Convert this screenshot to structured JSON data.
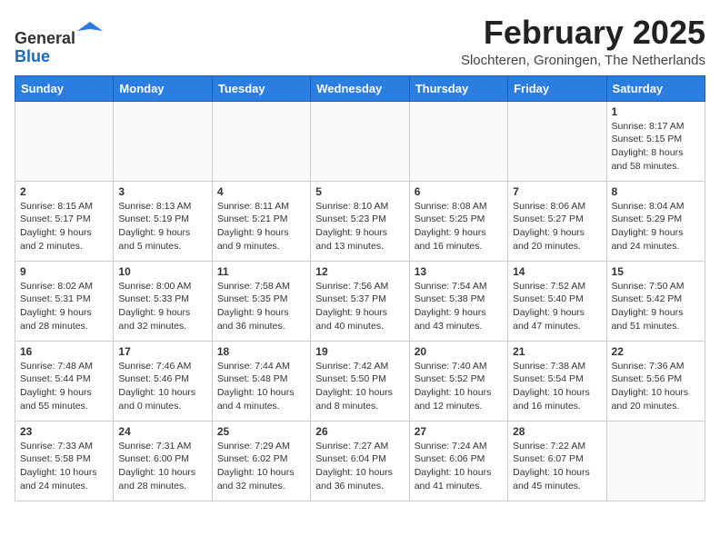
{
  "header": {
    "logo_line1": "General",
    "logo_line2": "Blue",
    "month_year": "February 2025",
    "location": "Slochteren, Groningen, The Netherlands"
  },
  "weekdays": [
    "Sunday",
    "Monday",
    "Tuesday",
    "Wednesday",
    "Thursday",
    "Friday",
    "Saturday"
  ],
  "weeks": [
    [
      {
        "day": "",
        "info": ""
      },
      {
        "day": "",
        "info": ""
      },
      {
        "day": "",
        "info": ""
      },
      {
        "day": "",
        "info": ""
      },
      {
        "day": "",
        "info": ""
      },
      {
        "day": "",
        "info": ""
      },
      {
        "day": "1",
        "info": "Sunrise: 8:17 AM\nSunset: 5:15 PM\nDaylight: 8 hours and 58 minutes."
      }
    ],
    [
      {
        "day": "2",
        "info": "Sunrise: 8:15 AM\nSunset: 5:17 PM\nDaylight: 9 hours and 2 minutes."
      },
      {
        "day": "3",
        "info": "Sunrise: 8:13 AM\nSunset: 5:19 PM\nDaylight: 9 hours and 5 minutes."
      },
      {
        "day": "4",
        "info": "Sunrise: 8:11 AM\nSunset: 5:21 PM\nDaylight: 9 hours and 9 minutes."
      },
      {
        "day": "5",
        "info": "Sunrise: 8:10 AM\nSunset: 5:23 PM\nDaylight: 9 hours and 13 minutes."
      },
      {
        "day": "6",
        "info": "Sunrise: 8:08 AM\nSunset: 5:25 PM\nDaylight: 9 hours and 16 minutes."
      },
      {
        "day": "7",
        "info": "Sunrise: 8:06 AM\nSunset: 5:27 PM\nDaylight: 9 hours and 20 minutes."
      },
      {
        "day": "8",
        "info": "Sunrise: 8:04 AM\nSunset: 5:29 PM\nDaylight: 9 hours and 24 minutes."
      }
    ],
    [
      {
        "day": "9",
        "info": "Sunrise: 8:02 AM\nSunset: 5:31 PM\nDaylight: 9 hours and 28 minutes."
      },
      {
        "day": "10",
        "info": "Sunrise: 8:00 AM\nSunset: 5:33 PM\nDaylight: 9 hours and 32 minutes."
      },
      {
        "day": "11",
        "info": "Sunrise: 7:58 AM\nSunset: 5:35 PM\nDaylight: 9 hours and 36 minutes."
      },
      {
        "day": "12",
        "info": "Sunrise: 7:56 AM\nSunset: 5:37 PM\nDaylight: 9 hours and 40 minutes."
      },
      {
        "day": "13",
        "info": "Sunrise: 7:54 AM\nSunset: 5:38 PM\nDaylight: 9 hours and 43 minutes."
      },
      {
        "day": "14",
        "info": "Sunrise: 7:52 AM\nSunset: 5:40 PM\nDaylight: 9 hours and 47 minutes."
      },
      {
        "day": "15",
        "info": "Sunrise: 7:50 AM\nSunset: 5:42 PM\nDaylight: 9 hours and 51 minutes."
      }
    ],
    [
      {
        "day": "16",
        "info": "Sunrise: 7:48 AM\nSunset: 5:44 PM\nDaylight: 9 hours and 55 minutes."
      },
      {
        "day": "17",
        "info": "Sunrise: 7:46 AM\nSunset: 5:46 PM\nDaylight: 10 hours and 0 minutes."
      },
      {
        "day": "18",
        "info": "Sunrise: 7:44 AM\nSunset: 5:48 PM\nDaylight: 10 hours and 4 minutes."
      },
      {
        "day": "19",
        "info": "Sunrise: 7:42 AM\nSunset: 5:50 PM\nDaylight: 10 hours and 8 minutes."
      },
      {
        "day": "20",
        "info": "Sunrise: 7:40 AM\nSunset: 5:52 PM\nDaylight: 10 hours and 12 minutes."
      },
      {
        "day": "21",
        "info": "Sunrise: 7:38 AM\nSunset: 5:54 PM\nDaylight: 10 hours and 16 minutes."
      },
      {
        "day": "22",
        "info": "Sunrise: 7:36 AM\nSunset: 5:56 PM\nDaylight: 10 hours and 20 minutes."
      }
    ],
    [
      {
        "day": "23",
        "info": "Sunrise: 7:33 AM\nSunset: 5:58 PM\nDaylight: 10 hours and 24 minutes."
      },
      {
        "day": "24",
        "info": "Sunrise: 7:31 AM\nSunset: 6:00 PM\nDaylight: 10 hours and 28 minutes."
      },
      {
        "day": "25",
        "info": "Sunrise: 7:29 AM\nSunset: 6:02 PM\nDaylight: 10 hours and 32 minutes."
      },
      {
        "day": "26",
        "info": "Sunrise: 7:27 AM\nSunset: 6:04 PM\nDaylight: 10 hours and 36 minutes."
      },
      {
        "day": "27",
        "info": "Sunrise: 7:24 AM\nSunset: 6:06 PM\nDaylight: 10 hours and 41 minutes."
      },
      {
        "day": "28",
        "info": "Sunrise: 7:22 AM\nSunset: 6:07 PM\nDaylight: 10 hours and 45 minutes."
      },
      {
        "day": "",
        "info": ""
      }
    ]
  ]
}
